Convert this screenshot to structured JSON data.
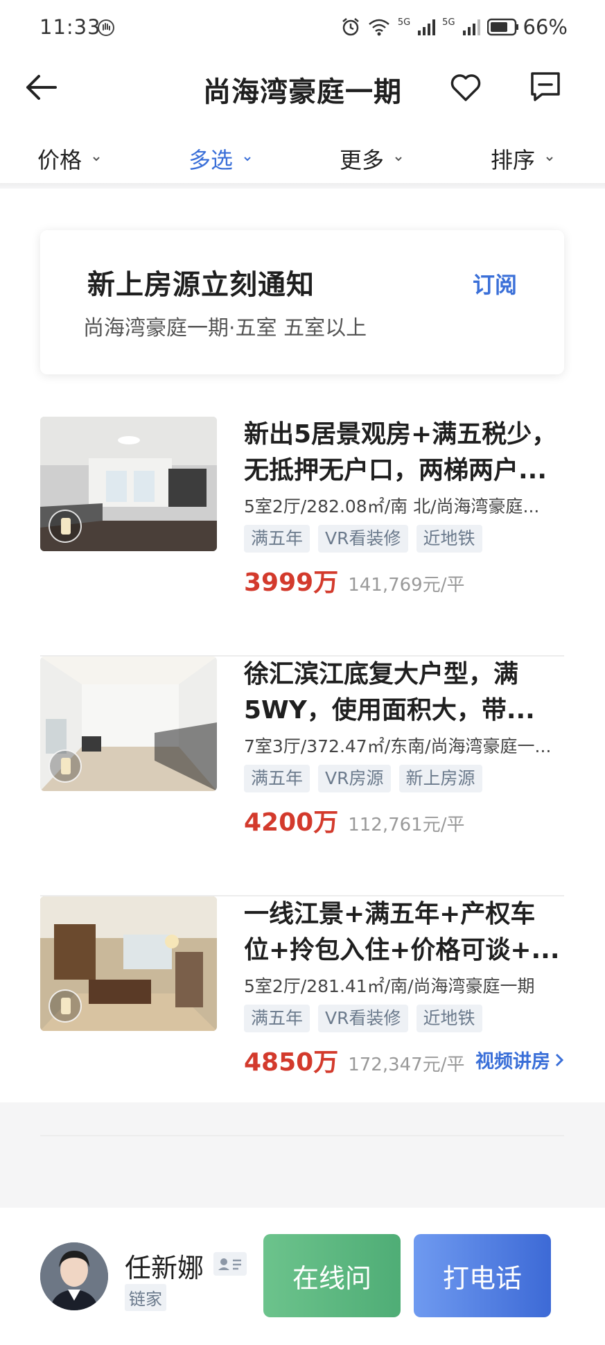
{
  "status_bar": {
    "time": "11:33",
    "net1": "5G",
    "net2": "5G",
    "battery": "66%"
  },
  "header": {
    "title": "尚海湾豪庭一期",
    "back_icon": "back-arrow-icon",
    "favorite_icon": "heart-icon",
    "message_icon": "chat-icon"
  },
  "filters": [
    {
      "label": "价格",
      "active": false
    },
    {
      "label": "多选",
      "active": true
    },
    {
      "label": "更多",
      "active": false
    },
    {
      "label": "排序",
      "active": false
    }
  ],
  "subscribe": {
    "title": "新上房源立刻通知",
    "desc": "尚海湾豪庭一期·五室 五室以上",
    "button": "订阅"
  },
  "listings": [
    {
      "title_line1": "新出5居景观房+满五税少，",
      "title_line2": "无抵押无户口，两梯两户...",
      "meta": "5室2厅/282.08㎡/南 北/尚海湾豪庭...",
      "tags": [
        "满五年",
        "VR看装修",
        "近地铁"
      ],
      "price": "3999万",
      "unit_price": "141,769元/平"
    },
    {
      "title_line1": "徐汇滨江底复大户型，满",
      "title_line2": "5WY，使用面积大，带...",
      "meta": "7室3厅/372.47㎡/东南/尚海湾豪庭一...",
      "tags": [
        "满五年",
        "VR房源",
        "新上房源"
      ],
      "price": "4200万",
      "unit_price": "112,761元/平"
    },
    {
      "title_line1": "一线江景+满五年+产权车",
      "title_line2": "位+拎包入住+价格可谈+...",
      "meta": "5室2厅/281.41㎡/南/尚海湾豪庭一期",
      "tags": [
        "满五年",
        "VR看装修",
        "近地铁"
      ],
      "price": "4850万",
      "unit_price": "172,347元/平",
      "video_link": "视频讲房"
    }
  ],
  "agent": {
    "name": "任新娜",
    "company": "链家",
    "online_button": "在线问",
    "call_button": "打电话"
  },
  "colors": {
    "accent": "#3a6fd8",
    "price": "#d33a2c",
    "online": "#56b37d",
    "call": "#4a78e0"
  }
}
